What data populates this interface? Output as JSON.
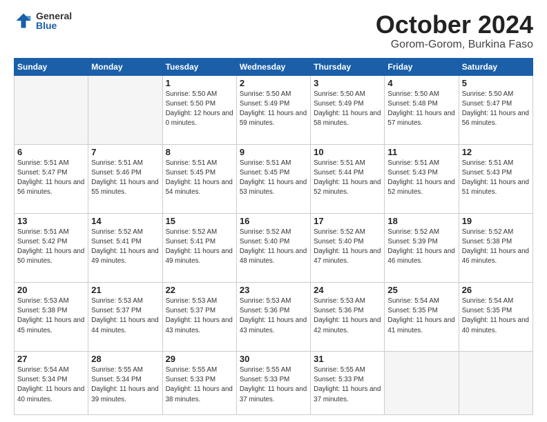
{
  "logo": {
    "general": "General",
    "blue": "Blue"
  },
  "title": {
    "month": "October 2024",
    "location": "Gorom-Gorom, Burkina Faso"
  },
  "header_days": [
    "Sunday",
    "Monday",
    "Tuesday",
    "Wednesday",
    "Thursday",
    "Friday",
    "Saturday"
  ],
  "weeks": [
    [
      {
        "day": "",
        "info": ""
      },
      {
        "day": "",
        "info": ""
      },
      {
        "day": "1",
        "info": "Sunrise: 5:50 AM\nSunset: 5:50 PM\nDaylight: 12 hours\nand 0 minutes."
      },
      {
        "day": "2",
        "info": "Sunrise: 5:50 AM\nSunset: 5:49 PM\nDaylight: 11 hours\nand 59 minutes."
      },
      {
        "day": "3",
        "info": "Sunrise: 5:50 AM\nSunset: 5:49 PM\nDaylight: 11 hours\nand 58 minutes."
      },
      {
        "day": "4",
        "info": "Sunrise: 5:50 AM\nSunset: 5:48 PM\nDaylight: 11 hours\nand 57 minutes."
      },
      {
        "day": "5",
        "info": "Sunrise: 5:50 AM\nSunset: 5:47 PM\nDaylight: 11 hours\nand 56 minutes."
      }
    ],
    [
      {
        "day": "6",
        "info": "Sunrise: 5:51 AM\nSunset: 5:47 PM\nDaylight: 11 hours\nand 56 minutes."
      },
      {
        "day": "7",
        "info": "Sunrise: 5:51 AM\nSunset: 5:46 PM\nDaylight: 11 hours\nand 55 minutes."
      },
      {
        "day": "8",
        "info": "Sunrise: 5:51 AM\nSunset: 5:45 PM\nDaylight: 11 hours\nand 54 minutes."
      },
      {
        "day": "9",
        "info": "Sunrise: 5:51 AM\nSunset: 5:45 PM\nDaylight: 11 hours\nand 53 minutes."
      },
      {
        "day": "10",
        "info": "Sunrise: 5:51 AM\nSunset: 5:44 PM\nDaylight: 11 hours\nand 52 minutes."
      },
      {
        "day": "11",
        "info": "Sunrise: 5:51 AM\nSunset: 5:43 PM\nDaylight: 11 hours\nand 52 minutes."
      },
      {
        "day": "12",
        "info": "Sunrise: 5:51 AM\nSunset: 5:43 PM\nDaylight: 11 hours\nand 51 minutes."
      }
    ],
    [
      {
        "day": "13",
        "info": "Sunrise: 5:51 AM\nSunset: 5:42 PM\nDaylight: 11 hours\nand 50 minutes."
      },
      {
        "day": "14",
        "info": "Sunrise: 5:52 AM\nSunset: 5:41 PM\nDaylight: 11 hours\nand 49 minutes."
      },
      {
        "day": "15",
        "info": "Sunrise: 5:52 AM\nSunset: 5:41 PM\nDaylight: 11 hours\nand 49 minutes."
      },
      {
        "day": "16",
        "info": "Sunrise: 5:52 AM\nSunset: 5:40 PM\nDaylight: 11 hours\nand 48 minutes."
      },
      {
        "day": "17",
        "info": "Sunrise: 5:52 AM\nSunset: 5:40 PM\nDaylight: 11 hours\nand 47 minutes."
      },
      {
        "day": "18",
        "info": "Sunrise: 5:52 AM\nSunset: 5:39 PM\nDaylight: 11 hours\nand 46 minutes."
      },
      {
        "day": "19",
        "info": "Sunrise: 5:52 AM\nSunset: 5:38 PM\nDaylight: 11 hours\nand 46 minutes."
      }
    ],
    [
      {
        "day": "20",
        "info": "Sunrise: 5:53 AM\nSunset: 5:38 PM\nDaylight: 11 hours\nand 45 minutes."
      },
      {
        "day": "21",
        "info": "Sunrise: 5:53 AM\nSunset: 5:37 PM\nDaylight: 11 hours\nand 44 minutes."
      },
      {
        "day": "22",
        "info": "Sunrise: 5:53 AM\nSunset: 5:37 PM\nDaylight: 11 hours\nand 43 minutes."
      },
      {
        "day": "23",
        "info": "Sunrise: 5:53 AM\nSunset: 5:36 PM\nDaylight: 11 hours\nand 43 minutes."
      },
      {
        "day": "24",
        "info": "Sunrise: 5:53 AM\nSunset: 5:36 PM\nDaylight: 11 hours\nand 42 minutes."
      },
      {
        "day": "25",
        "info": "Sunrise: 5:54 AM\nSunset: 5:35 PM\nDaylight: 11 hours\nand 41 minutes."
      },
      {
        "day": "26",
        "info": "Sunrise: 5:54 AM\nSunset: 5:35 PM\nDaylight: 11 hours\nand 40 minutes."
      }
    ],
    [
      {
        "day": "27",
        "info": "Sunrise: 5:54 AM\nSunset: 5:34 PM\nDaylight: 11 hours\nand 40 minutes."
      },
      {
        "day": "28",
        "info": "Sunrise: 5:55 AM\nSunset: 5:34 PM\nDaylight: 11 hours\nand 39 minutes."
      },
      {
        "day": "29",
        "info": "Sunrise: 5:55 AM\nSunset: 5:33 PM\nDaylight: 11 hours\nand 38 minutes."
      },
      {
        "day": "30",
        "info": "Sunrise: 5:55 AM\nSunset: 5:33 PM\nDaylight: 11 hours\nand 37 minutes."
      },
      {
        "day": "31",
        "info": "Sunrise: 5:55 AM\nSunset: 5:33 PM\nDaylight: 11 hours\nand 37 minutes."
      },
      {
        "day": "",
        "info": ""
      },
      {
        "day": "",
        "info": ""
      }
    ]
  ]
}
